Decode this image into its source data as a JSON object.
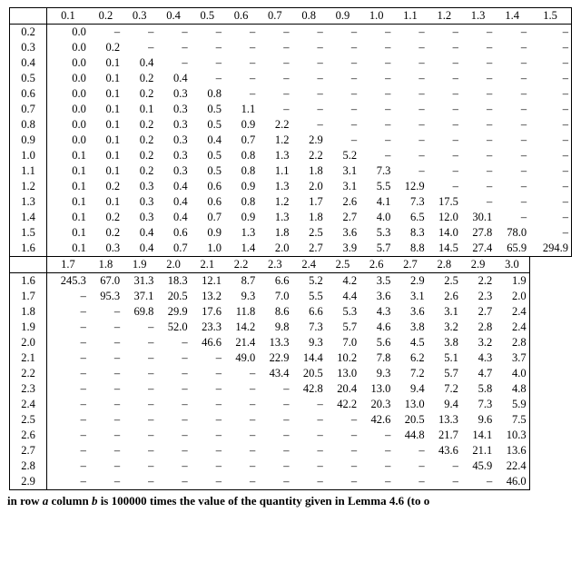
{
  "dash": "–",
  "caption_parts": {
    "p1": "in row ",
    "a": "a",
    "p2": " column ",
    "b": "b",
    "p3": " is 100000 times the value of the quantity given in Lemma 4.6 (to o"
  },
  "chart_data": {
    "type": "table",
    "title": "",
    "note": "cell value = 100000 × quantity in Lemma 4.6",
    "blocks": [
      {
        "col_headers": [
          "0.1",
          "0.2",
          "0.3",
          "0.4",
          "0.5",
          "0.6",
          "0.7",
          "0.8",
          "0.9",
          "1.0",
          "1.1",
          "1.2",
          "1.3",
          "1.4",
          "1.5"
        ],
        "rows": [
          {
            "a": "0.2",
            "cells": [
              "0.0",
              "–",
              "–",
              "–",
              "–",
              "–",
              "–",
              "–",
              "–",
              "–",
              "–",
              "–",
              "–",
              "–",
              "–"
            ]
          },
          {
            "a": "0.3",
            "cells": [
              "0.0",
              "0.2",
              "–",
              "–",
              "–",
              "–",
              "–",
              "–",
              "–",
              "–",
              "–",
              "–",
              "–",
              "–",
              "–"
            ]
          },
          {
            "a": "0.4",
            "cells": [
              "0.0",
              "0.1",
              "0.4",
              "–",
              "–",
              "–",
              "–",
              "–",
              "–",
              "–",
              "–",
              "–",
              "–",
              "–",
              "–"
            ]
          },
          {
            "a": "0.5",
            "cells": [
              "0.0",
              "0.1",
              "0.2",
              "0.4",
              "–",
              "–",
              "–",
              "–",
              "–",
              "–",
              "–",
              "–",
              "–",
              "–",
              "–"
            ]
          },
          {
            "a": "0.6",
            "cells": [
              "0.0",
              "0.1",
              "0.2",
              "0.3",
              "0.8",
              "–",
              "–",
              "–",
              "–",
              "–",
              "–",
              "–",
              "–",
              "–",
              "–"
            ]
          },
          {
            "a": "0.7",
            "cells": [
              "0.0",
              "0.1",
              "0.1",
              "0.3",
              "0.5",
              "1.1",
              "–",
              "–",
              "–",
              "–",
              "–",
              "–",
              "–",
              "–",
              "–"
            ]
          },
          {
            "a": "0.8",
            "cells": [
              "0.0",
              "0.1",
              "0.2",
              "0.3",
              "0.5",
              "0.9",
              "2.2",
              "–",
              "–",
              "–",
              "–",
              "–",
              "–",
              "–",
              "–"
            ]
          },
          {
            "a": "0.9",
            "cells": [
              "0.0",
              "0.1",
              "0.2",
              "0.3",
              "0.4",
              "0.7",
              "1.2",
              "2.9",
              "–",
              "–",
              "–",
              "–",
              "–",
              "–",
              "–"
            ]
          },
          {
            "a": "1.0",
            "cells": [
              "0.1",
              "0.1",
              "0.2",
              "0.3",
              "0.5",
              "0.8",
              "1.3",
              "2.2",
              "5.2",
              "–",
              "–",
              "–",
              "–",
              "–",
              "–"
            ]
          },
          {
            "a": "1.1",
            "cells": [
              "0.1",
              "0.1",
              "0.2",
              "0.3",
              "0.5",
              "0.8",
              "1.1",
              "1.8",
              "3.1",
              "7.3",
              "–",
              "–",
              "–",
              "–",
              "–"
            ]
          },
          {
            "a": "1.2",
            "cells": [
              "0.1",
              "0.2",
              "0.3",
              "0.4",
              "0.6",
              "0.9",
              "1.3",
              "2.0",
              "3.1",
              "5.5",
              "12.9",
              "–",
              "–",
              "–",
              "–"
            ]
          },
          {
            "a": "1.3",
            "cells": [
              "0.1",
              "0.1",
              "0.3",
              "0.4",
              "0.6",
              "0.8",
              "1.2",
              "1.7",
              "2.6",
              "4.1",
              "7.3",
              "17.5",
              "–",
              "–",
              "–"
            ]
          },
          {
            "a": "1.4",
            "cells": [
              "0.1",
              "0.2",
              "0.3",
              "0.4",
              "0.7",
              "0.9",
              "1.3",
              "1.8",
              "2.7",
              "4.0",
              "6.5",
              "12.0",
              "30.1",
              "–",
              "–"
            ]
          },
          {
            "a": "1.5",
            "cells": [
              "0.1",
              "0.2",
              "0.4",
              "0.6",
              "0.9",
              "1.3",
              "1.8",
              "2.5",
              "3.6",
              "5.3",
              "8.3",
              "14.0",
              "27.8",
              "78.0",
              "–"
            ]
          },
          {
            "a": "1.6",
            "cells": [
              "0.1",
              "0.3",
              "0.4",
              "0.7",
              "1.0",
              "1.4",
              "2.0",
              "2.7",
              "3.9",
              "5.7",
              "8.8",
              "14.5",
              "27.4",
              "65.9",
              "294.9"
            ]
          }
        ]
      },
      {
        "col_headers": [
          "1.7",
          "1.8",
          "1.9",
          "2.0",
          "2.1",
          "2.2",
          "2.3",
          "2.4",
          "2.5",
          "2.6",
          "2.7",
          "2.8",
          "2.9",
          "3.0"
        ],
        "rows": [
          {
            "a": "1.6",
            "cells": [
              "245.3",
              "67.0",
              "31.3",
              "18.3",
              "12.1",
              "8.7",
              "6.6",
              "5.2",
              "4.2",
              "3.5",
              "2.9",
              "2.5",
              "2.2",
              "1.9"
            ]
          },
          {
            "a": "1.7",
            "cells": [
              "–",
              "95.3",
              "37.1",
              "20.5",
              "13.2",
              "9.3",
              "7.0",
              "5.5",
              "4.4",
              "3.6",
              "3.1",
              "2.6",
              "2.3",
              "2.0"
            ]
          },
          {
            "a": "1.8",
            "cells": [
              "–",
              "–",
              "69.8",
              "29.9",
              "17.6",
              "11.8",
              "8.6",
              "6.6",
              "5.3",
              "4.3",
              "3.6",
              "3.1",
              "2.7",
              "2.4"
            ]
          },
          {
            "a": "1.9",
            "cells": [
              "–",
              "–",
              "–",
              "52.0",
              "23.3",
              "14.2",
              "9.8",
              "7.3",
              "5.7",
              "4.6",
              "3.8",
              "3.2",
              "2.8",
              "2.4"
            ]
          },
          {
            "a": "2.0",
            "cells": [
              "–",
              "–",
              "–",
              "–",
              "46.6",
              "21.4",
              "13.3",
              "9.3",
              "7.0",
              "5.6",
              "4.5",
              "3.8",
              "3.2",
              "2.8"
            ]
          },
          {
            "a": "2.1",
            "cells": [
              "–",
              "–",
              "–",
              "–",
              "–",
              "49.0",
              "22.9",
              "14.4",
              "10.2",
              "7.8",
              "6.2",
              "5.1",
              "4.3",
              "3.7"
            ]
          },
          {
            "a": "2.2",
            "cells": [
              "–",
              "–",
              "–",
              "–",
              "–",
              "–",
              "43.4",
              "20.5",
              "13.0",
              "9.3",
              "7.2",
              "5.7",
              "4.7",
              "4.0"
            ]
          },
          {
            "a": "2.3",
            "cells": [
              "–",
              "–",
              "–",
              "–",
              "–",
              "–",
              "–",
              "42.8",
              "20.4",
              "13.0",
              "9.4",
              "7.2",
              "5.8",
              "4.8"
            ]
          },
          {
            "a": "2.4",
            "cells": [
              "–",
              "–",
              "–",
              "–",
              "–",
              "–",
              "–",
              "–",
              "42.2",
              "20.3",
              "13.0",
              "9.4",
              "7.3",
              "5.9"
            ]
          },
          {
            "a": "2.5",
            "cells": [
              "–",
              "–",
              "–",
              "–",
              "–",
              "–",
              "–",
              "–",
              "–",
              "42.6",
              "20.5",
              "13.3",
              "9.6",
              "7.5"
            ]
          },
          {
            "a": "2.6",
            "cells": [
              "–",
              "–",
              "–",
              "–",
              "–",
              "–",
              "–",
              "–",
              "–",
              "–",
              "44.8",
              "21.7",
              "14.1",
              "10.3"
            ]
          },
          {
            "a": "2.7",
            "cells": [
              "–",
              "–",
              "–",
              "–",
              "–",
              "–",
              "–",
              "–",
              "–",
              "–",
              "–",
              "43.6",
              "21.1",
              "13.6"
            ]
          },
          {
            "a": "2.8",
            "cells": [
              "–",
              "–",
              "–",
              "–",
              "–",
              "–",
              "–",
              "–",
              "–",
              "–",
              "–",
              "–",
              "45.9",
              "22.4"
            ]
          },
          {
            "a": "2.9",
            "cells": [
              "–",
              "–",
              "–",
              "–",
              "–",
              "–",
              "–",
              "–",
              "–",
              "–",
              "–",
              "–",
              "–",
              "46.0"
            ]
          }
        ]
      }
    ]
  }
}
